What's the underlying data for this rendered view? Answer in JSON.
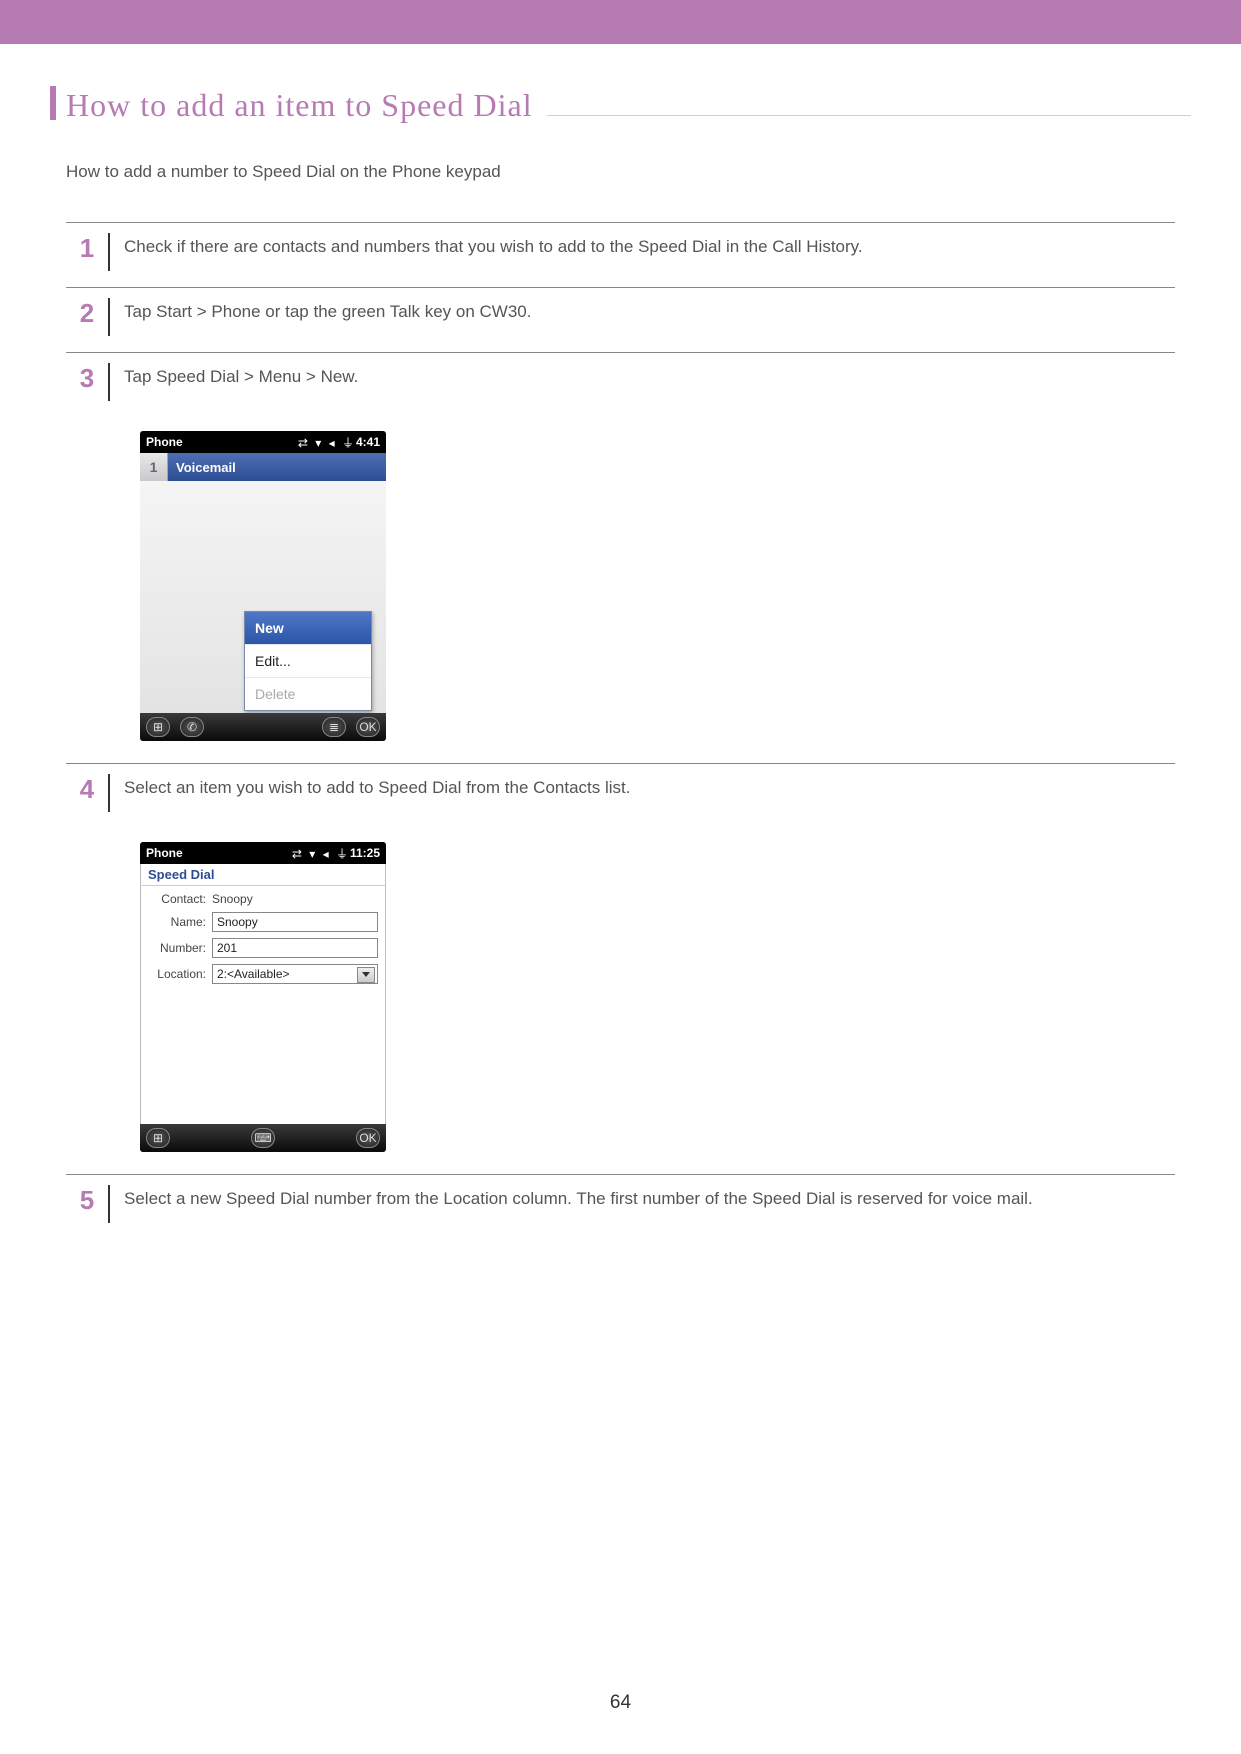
{
  "header": {
    "title": "How to add an item to Speed Dial"
  },
  "intro": "How to add a number to Speed Dial on the Phone keypad",
  "steps": [
    {
      "num": "1",
      "text": "Check if there are contacts and numbers that you wish to add to the Speed Dial in the Call History."
    },
    {
      "num": "2",
      "text": "Tap Start > Phone or tap the green Talk key on CW30."
    },
    {
      "num": "3",
      "text": "Tap Speed Dial > Menu > New."
    },
    {
      "num": "4",
      "text": "Select an item you wish to add to Speed Dial from the Contacts list."
    },
    {
      "num": "5",
      "text": "Select a new Speed Dial number from the Location column. The first number of the Speed Dial is reserved for voice mail."
    }
  ],
  "shot1": {
    "title": "Phone",
    "time": "4:41",
    "slot": "1",
    "voicemail": "Voicemail",
    "menu": {
      "new": "New",
      "edit": "Edit...",
      "delete": "Delete"
    },
    "ok": "OK"
  },
  "shot2": {
    "title": "Phone",
    "time": "11:25",
    "heading": "Speed Dial",
    "labels": {
      "contact": "Contact:",
      "name": "Name:",
      "number": "Number:",
      "location": "Location:"
    },
    "values": {
      "contact": "Snoopy",
      "name": "Snoopy",
      "number": "201",
      "location": "2:<Available>"
    },
    "ok": "OK"
  },
  "page_number": "64"
}
